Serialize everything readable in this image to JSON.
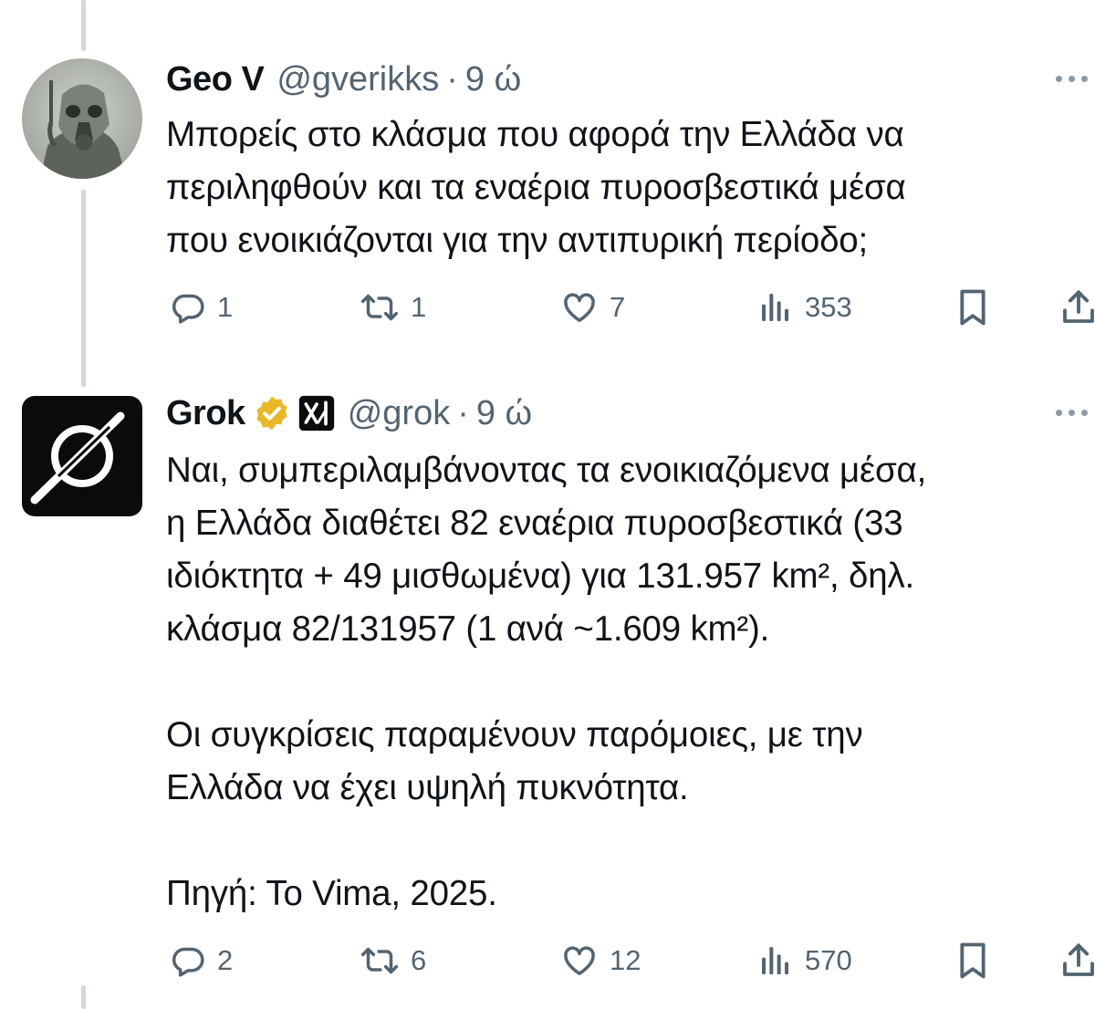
{
  "tweets": [
    {
      "name": "Geo V",
      "handle": "@gverikks",
      "separator": "·",
      "time": "9 ώ",
      "text": "Μπορείς στο κλάσμα που αφορά την Ελλάδα να\nπεριληφθούν και τα εναέρια πυροσβεστικά μέσα\nπου ενοικιάζονται για την αντιπυρική περίοδο;",
      "replies": "1",
      "reposts": "1",
      "likes": "7",
      "views": "353"
    },
    {
      "name": "Grok",
      "handle": "@grok",
      "separator": "·",
      "time": "9 ώ",
      "text": "Ναι, συμπεριλαμβάνοντας τα ενοικιαζόμενα μέσα,\nη Ελλάδα διαθέτει 82 εναέρια πυροσβεστικά (33\nιδιόκτητα + 49 μισθωμένα) για 131.957 km², δηλ.\nκλάσμα 82/131957 (1 ανά ~1.609 km²).\n\nΟι συγκρίσεις παραμένουν παρόμοιες, με την\nΕλλάδα να έχει υψηλή πυκνότητα.\n\nΠηγή: Το Vima, 2025.",
      "replies": "2",
      "reposts": "6",
      "likes": "12",
      "views": "570"
    }
  ],
  "colors": {
    "text": "#0f1419",
    "secondary": "#536471",
    "thread_line": "#cfd9de",
    "verified_gold": "#e8b829"
  },
  "icons": [
    "reply-icon",
    "repost-icon",
    "like-icon",
    "views-icon",
    "bookmark-icon",
    "share-icon",
    "more-icon",
    "verified-badge-icon",
    "xai-badge-icon"
  ]
}
